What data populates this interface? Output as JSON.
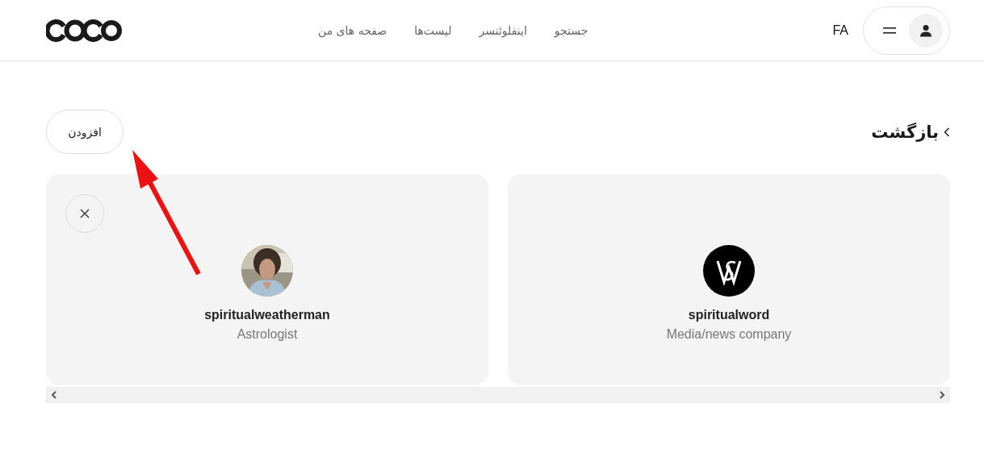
{
  "header": {
    "nav": [
      {
        "label": "جستجو"
      },
      {
        "label": "اینفلوئنسر"
      },
      {
        "label": "لیست‌ها"
      },
      {
        "label": "صفحه های من"
      }
    ],
    "language": "FA"
  },
  "page": {
    "back_label": "بازگشت",
    "add_button": "افزودن"
  },
  "cards": [
    {
      "kind": "logo",
      "username": "spiritualword",
      "category": "Media/news company",
      "removable": false
    },
    {
      "username": "spiritualweatherman",
      "category": "Astrologist",
      "removable": true
    }
  ]
}
